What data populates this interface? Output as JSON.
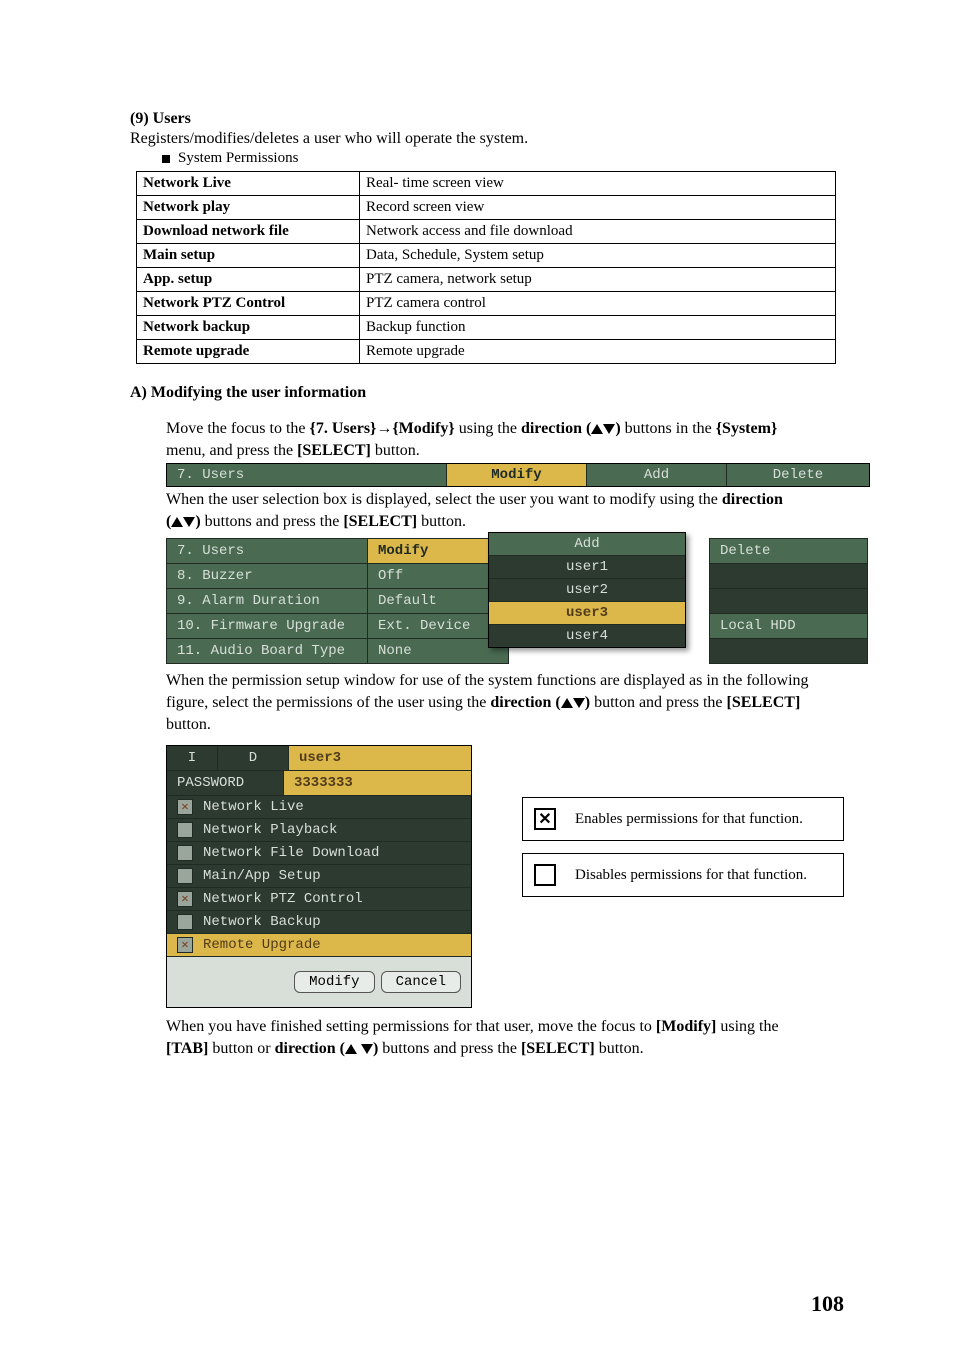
{
  "section": {
    "heading": "(9) Users",
    "intro": "Registers/modifies/deletes a user who will operate the system.",
    "bullet": "System Permissions"
  },
  "perm_table": {
    "rows": [
      {
        "label": "Network Live",
        "desc": "Real- time screen view"
      },
      {
        "label": "Network play",
        "desc": "Record screen view"
      },
      {
        "label": "Download network file",
        "desc": "Network access and file download"
      },
      {
        "label": "Main setup",
        "desc": "Data, Schedule, System setup"
      },
      {
        "label": "App. setup",
        "desc": "PTZ camera, network setup"
      },
      {
        "label": "Network PTZ Control",
        "desc": "PTZ camera control"
      },
      {
        "label": "Network backup",
        "desc": "Backup function"
      },
      {
        "label": "Remote upgrade",
        "desc": "Remote upgrade"
      }
    ]
  },
  "modA": {
    "heading": "A) Modifying the user information",
    "p1a": "Move the focus to the ",
    "p1b": "{7. Users}→{Modify}",
    "p1c": " using the ",
    "p1d": "direction (",
    "p1e": ") ",
    "p1f": "buttons in the ",
    "p1g": "{System}",
    "p1h": " menu, and press the ",
    "p1i": "[SELECT]",
    "p1j": " button."
  },
  "strip1": {
    "label": "7. Users",
    "modify": "Modify",
    "add": "Add",
    "delete": "Delete"
  },
  "after_strip": {
    "p1a": "When the user selection box is displayed, select the user you want to modify using the ",
    "p1b": "direction",
    "p2a": " (",
    "p2b": ")",
    "p2c": " buttons and press the ",
    "p2d": "[SELECT]",
    "p2e": " button."
  },
  "menu_table": {
    "rows": [
      {
        "c1": "7. Users",
        "c2": "Modify",
        "c2sel": true,
        "c4": "Delete",
        "c4bg": true
      },
      {
        "c1": "8. Buzzer",
        "c2": "Off",
        "c4": ""
      },
      {
        "c1": "9. Alarm Duration",
        "c2": "Default",
        "c4": ""
      },
      {
        "c1": "10. Firmware Upgrade",
        "c2": "Ext. Device",
        "c4": "Local HDD",
        "c4bg": true
      },
      {
        "c1": "11. Audio Board Type",
        "c2": "None",
        "c4": ""
      }
    ],
    "popup_header": "Add",
    "popup": [
      "user1",
      "user2",
      "user3",
      "user4"
    ],
    "popup_selected": 2
  },
  "after_table": {
    "p1": "When the permission setup window for use of the system functions are displayed as in the following",
    "p2a": " figure, select the permissions of the user using the ",
    "p2b": "direction (",
    "p2c": ")",
    "p2d": " button and press the ",
    "p2e": "[SELECT]",
    "p3": " button."
  },
  "dlg": {
    "id_label": "I",
    "d_label": "D",
    "user": "user3",
    "pwd_label": "PASSWORD",
    "pwd": "3333333",
    "items": [
      {
        "label": "Network Live",
        "checked": true,
        "sel": false
      },
      {
        "label": "Network Playback",
        "checked": false,
        "sel": false
      },
      {
        "label": "Network File Download",
        "checked": false,
        "sel": false
      },
      {
        "label": "Main/App Setup",
        "checked": false,
        "sel": false
      },
      {
        "label": "Network PTZ Control",
        "checked": true,
        "sel": false
      },
      {
        "label": "Network Backup",
        "checked": false,
        "sel": false
      },
      {
        "label": "Remote Upgrade",
        "checked": true,
        "sel": true
      }
    ],
    "modify": "Modify",
    "cancel": "Cancel"
  },
  "legend": {
    "on": "Enables permissions for that function.",
    "off": "Disables permissions for that function."
  },
  "final": {
    "p1a": "When you have finished setting permissions for that user, move the focus to ",
    "p1b": "[Modify]",
    "p1c": " using the",
    "p2a": "[TAB]",
    "p2b": " button or ",
    "p2c": "direction (",
    "p2d": ")",
    "p2e": " buttons and press the ",
    "p2f": "[SELECT]",
    "p2g": " button."
  },
  "page_number": "108"
}
